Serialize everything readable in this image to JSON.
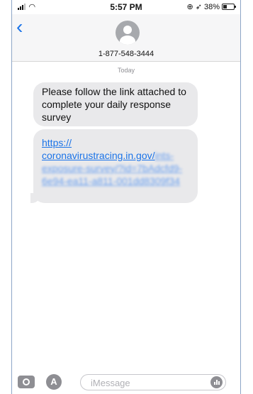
{
  "status_bar": {
    "time": "5:57 PM",
    "battery_percent": "38%",
    "battery_level": 0.38,
    "icons": [
      "signal-icon",
      "wifi-icon",
      "location-icon",
      "alarm-icon",
      "battery-icon"
    ]
  },
  "header": {
    "contact": "1-877-548-3444",
    "icons": [
      "back-chevron-icon",
      "avatar-icon"
    ]
  },
  "conversation": {
    "date_label": "Today",
    "messages": [
      {
        "text": "Please follow the link attached to complete your daily response survey"
      },
      {
        "link_visible": "https:// coronavirustracing.in.gov/",
        "link_obscured": "ints-exposure-survey/?id=7bAdcfd9-6e94-ea11-a811-001dd8309f34"
      }
    ]
  },
  "input_bar": {
    "placeholder": "iMessage",
    "value": "",
    "icons": [
      "camera-icon",
      "appstore-icon",
      "audio-icon"
    ]
  },
  "colors": {
    "link": "#1a73e8",
    "bubble": "#e9e9eb",
    "frame_border": "#8da6c7"
  }
}
